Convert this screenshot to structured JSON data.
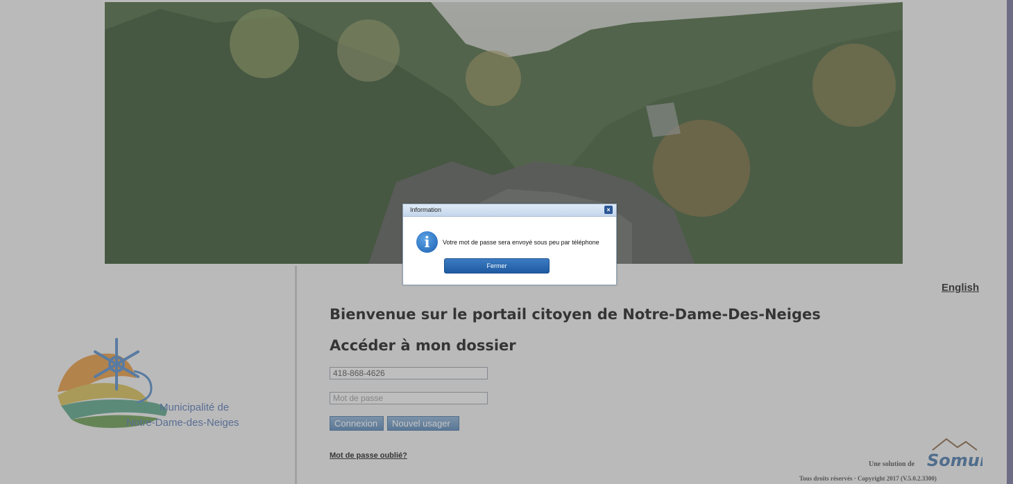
{
  "header": {
    "language_link": "English"
  },
  "main": {
    "welcome_title": "Bienvenue sur le portail citoyen de Notre-Dame-Des-Neiges",
    "section_title": "Accéder à mon dossier",
    "phone_value": "418-868-4626",
    "password_placeholder": "Mot de passe",
    "login_button": "Connexion",
    "new_user_button": "Nouvel usager",
    "forgot_link": "Mot de passe oublié?"
  },
  "logo": {
    "line1": "Municipalité de",
    "line2": "Notre-Dame-des-Neiges"
  },
  "footer": {
    "solution_label": "Une solution de",
    "brand": "Somum",
    "copyright": "Tous droits réservés · Copyright 2017 (V.5.0.2.3300)"
  },
  "dialog": {
    "title": "Information",
    "close_icon": "×",
    "message": "Votre mot de passe sera envoyé sous peu par téléphone",
    "button": "Fermer"
  },
  "colors": {
    "accent": "#2b5796",
    "logo_text": "#5a78b2"
  },
  "icons": [
    "close-icon",
    "info-icon",
    "snowflake-logo"
  ]
}
